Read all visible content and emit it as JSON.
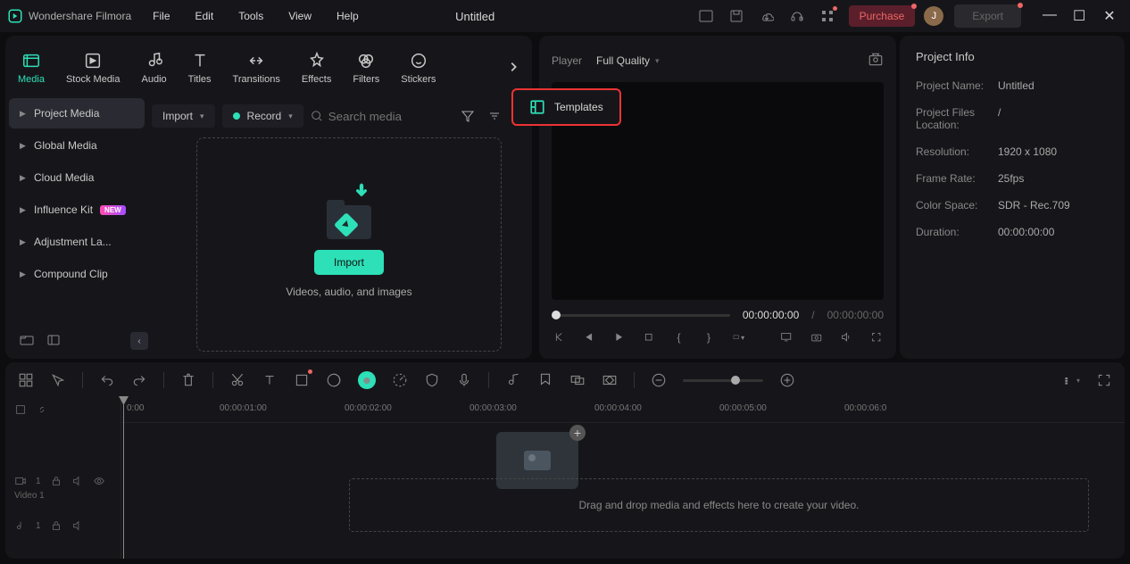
{
  "app_name": "Wondershare Filmora",
  "menus": [
    "File",
    "Edit",
    "Tools",
    "View",
    "Help"
  ],
  "document_title": "Untitled",
  "purchase_label": "Purchase",
  "avatar_letter": "J",
  "export_label": "Export",
  "tool_tabs": {
    "media": "Media",
    "stock_media": "Stock Media",
    "audio": "Audio",
    "titles": "Titles",
    "transitions": "Transitions",
    "effects": "Effects",
    "filters": "Filters",
    "stickers": "Stickers"
  },
  "tree": {
    "project_media": "Project Media",
    "global_media": "Global Media",
    "cloud_media": "Cloud Media",
    "influence_kit": "Influence Kit",
    "influence_badge": "NEW",
    "adjustment": "Adjustment La...",
    "compound": "Compound Clip"
  },
  "media_controls": {
    "import_btn": "Import",
    "record_btn": "Record",
    "search_placeholder": "Search media"
  },
  "dropzone": {
    "import": "Import",
    "hint": "Videos, audio, and images"
  },
  "templates_label": "Templates",
  "preview": {
    "player": "Player",
    "quality": "Full Quality",
    "time_current": "00:00:00:00",
    "time_separator": "/",
    "time_total": "00:00:00:00"
  },
  "project_info": {
    "title": "Project Info",
    "name_k": "Project Name:",
    "name_v": "Untitled",
    "loc_k": "Project Files Location:",
    "loc_v": "/",
    "res_k": "Resolution:",
    "res_v": "1920 x 1080",
    "fr_k": "Frame Rate:",
    "fr_v": "25fps",
    "cs_k": "Color Space:",
    "cs_v": "SDR - Rec.709",
    "dur_k": "Duration:",
    "dur_v": "00:00:00:00"
  },
  "timeline": {
    "ticks": [
      "0:00",
      "00:00:01:00",
      "00:00:02:00",
      "00:00:03:00",
      "00:00:04:00",
      "00:00:05:00",
      "00:00:06:0"
    ],
    "video_track": "Video 1",
    "drop_hint": "Drag and drop media and effects here to create your video."
  }
}
